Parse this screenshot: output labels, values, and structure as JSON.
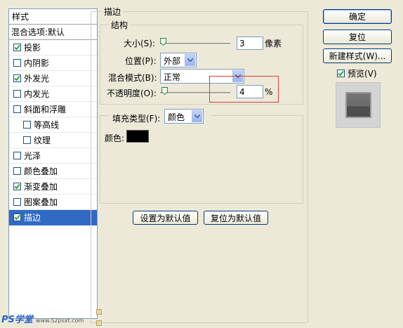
{
  "style_list": {
    "header": "样式",
    "items": [
      {
        "label": "混合选项:默认",
        "has_checkbox": false,
        "checked": false,
        "indent": false,
        "selected": false,
        "bold": false
      },
      {
        "label": "投影",
        "has_checkbox": true,
        "checked": true,
        "indent": false,
        "selected": false
      },
      {
        "label": "内阴影",
        "has_checkbox": true,
        "checked": false,
        "indent": false,
        "selected": false
      },
      {
        "label": "外发光",
        "has_checkbox": true,
        "checked": true,
        "indent": false,
        "selected": false
      },
      {
        "label": "内发光",
        "has_checkbox": true,
        "checked": false,
        "indent": false,
        "selected": false
      },
      {
        "label": "斜面和浮雕",
        "has_checkbox": true,
        "checked": false,
        "indent": false,
        "selected": false
      },
      {
        "label": "等高线",
        "has_checkbox": true,
        "checked": false,
        "indent": true,
        "selected": false
      },
      {
        "label": "纹理",
        "has_checkbox": true,
        "checked": false,
        "indent": true,
        "selected": false
      },
      {
        "label": "光泽",
        "has_checkbox": true,
        "checked": false,
        "indent": false,
        "selected": false
      },
      {
        "label": "颜色叠加",
        "has_checkbox": true,
        "checked": false,
        "indent": false,
        "selected": false
      },
      {
        "label": "渐变叠加",
        "has_checkbox": true,
        "checked": true,
        "indent": false,
        "selected": false
      },
      {
        "label": "图案叠加",
        "has_checkbox": true,
        "checked": false,
        "indent": false,
        "selected": false
      },
      {
        "label": "描边",
        "has_checkbox": true,
        "checked": true,
        "indent": false,
        "selected": true
      }
    ]
  },
  "stroke": {
    "title": "描边",
    "structure": {
      "title": "结构",
      "size_label": "大小(S):",
      "size_value": "3",
      "size_unit": "像素",
      "position_label": "位置(P):",
      "position_value": "外部",
      "blend_label": "混合模式(B):",
      "blend_value": "正常",
      "opacity_label": "不透明度(O):",
      "opacity_value": "4",
      "opacity_unit": "%"
    },
    "fill": {
      "type_label": "填充类型(F):",
      "type_value": "颜色",
      "color_label": "颜色:",
      "color_swatch": "#000000"
    },
    "set_default_button": "设置为默认值",
    "reset_default_button": "复位为默认值"
  },
  "buttons": {
    "ok": "确定",
    "reset": "复位",
    "new_style": "新建样式(W)...",
    "preview_label": "预览(V)",
    "preview_checked": true
  },
  "highlight_color": "#e0393b",
  "accent_color": "#316ac5",
  "watermark": {
    "brand": "PS学堂",
    "url": "www.52psxt.com"
  }
}
